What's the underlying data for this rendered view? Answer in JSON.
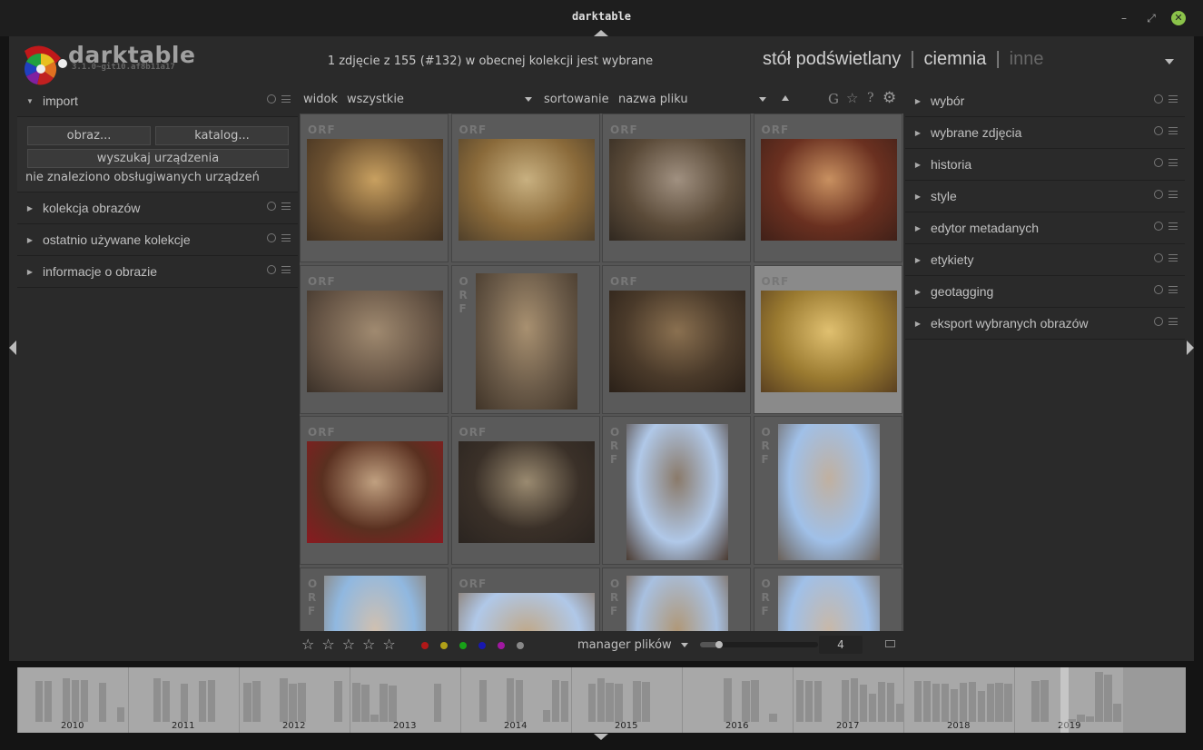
{
  "window": {
    "title": "darktable"
  },
  "brand": {
    "name": "darktable",
    "version": "3.1.0~git10.af8b11a17"
  },
  "header": {
    "info": "1 zdjęcie z 155 (#132) w obecnej kolekcji jest wybrane",
    "views": [
      "stół podświetlany",
      "ciemnia",
      "inne"
    ],
    "separator": "|"
  },
  "left": {
    "import": {
      "label": "import",
      "buttons": {
        "image": "obraz...",
        "folder": "katalog...",
        "scan": "wyszukaj urządzenia"
      },
      "no_devices": "nie znaleziono obsługiwanych urządzeń"
    },
    "modules": [
      "kolekcja obrazów",
      "ostatnio używane kolekcje",
      "informacje o obrazie"
    ]
  },
  "right": {
    "modules": [
      "wybór",
      "wybrane zdjęcia",
      "historia",
      "style",
      "edytor metadanych",
      "etykiety",
      "geotagging",
      "eksport wybranych obrazów"
    ]
  },
  "toolbar": {
    "view_label": "widok",
    "view_value": "wszystkie",
    "sort_label": "sortowanie",
    "sort_value": "nazwa pliku",
    "icon_g": "G",
    "icon_star": "☆",
    "icon_help": "?"
  },
  "grid": {
    "badge": "ORF",
    "thumbs": [
      {
        "colors": [
          "#6b5030",
          "#c8a060",
          "#403020"
        ]
      },
      {
        "colors": [
          "#8a6a3a",
          "#c8b080",
          "#50402a"
        ]
      },
      {
        "colors": [
          "#5a4a38",
          "#a09080",
          "#302820"
        ]
      },
      {
        "colors": [
          "#6a3020",
          "#c89060",
          "#402018"
        ]
      },
      {
        "colors": [
          "#6a5848",
          "#a08a70",
          "#3a3028"
        ]
      },
      {
        "colors": [
          "#6a5a48",
          "#a89070",
          "#403428"
        ]
      },
      {
        "colors": [
          "#4a3a2a",
          "#8a7050",
          "#2a2018"
        ]
      },
      {
        "colors": [
          "#9a7a30",
          "#e0c070",
          "#5a4020"
        ]
      },
      {
        "colors": [
          "#5a3020",
          "#c0a080",
          "#8a1a20"
        ]
      },
      {
        "colors": [
          "#3a3028",
          "#9a8a70",
          "#2a2420"
        ]
      },
      {
        "colors": [
          "#b0c8e8",
          "#8a7a6a",
          "#4a3a30"
        ]
      },
      {
        "colors": [
          "#a0c0e8",
          "#c0b0a0",
          "#6a6058"
        ]
      },
      {
        "colors": [
          "#90b8e0",
          "#d0c0b0",
          "#8a7a6a"
        ]
      },
      {
        "colors": [
          "#b0c8e8",
          "#c0a888",
          "#806850"
        ]
      },
      {
        "colors": [
          "#a8c0e0",
          "#b09878",
          "#705840"
        ]
      },
      {
        "colors": [
          "#a0c0e8",
          "#c8b8a8",
          "#7a6a5a"
        ]
      }
    ],
    "selected_index": 7
  },
  "bottom": {
    "stars": [
      "☆",
      "☆",
      "☆",
      "☆",
      "☆"
    ],
    "color_labels": [
      "#b01818",
      "#b0a018",
      "#18a018",
      "#1818b0",
      "#a018a0",
      "#888888"
    ],
    "layout_label": "manager plików",
    "zoom": "4"
  },
  "timeline": {
    "years": [
      "2010",
      "2011",
      "2012",
      "2013",
      "2014",
      "2015",
      "2016",
      "2017",
      "2018",
      "2019"
    ],
    "bars": [
      0,
      0,
      0.78,
      0.78,
      0,
      0.82,
      0.8,
      0.79,
      0,
      0.75,
      0,
      0.28,
      0,
      0,
      0,
      0.83,
      0.78,
      0,
      0.72,
      0,
      0.78,
      0.8,
      0,
      0,
      0,
      0.75,
      0.78,
      0,
      0,
      0.82,
      0.72,
      0.75,
      0,
      0,
      0,
      0.78,
      0,
      0.75,
      0.7,
      0.14,
      0.72,
      0.69,
      0,
      0,
      0,
      0,
      0.73,
      0,
      0,
      0,
      0,
      0.8,
      0,
      0,
      0.82,
      0.8,
      0,
      0,
      0.22,
      0.8,
      0.78,
      0,
      0,
      0.73,
      0.82,
      0.74,
      0.73,
      0,
      0.77,
      0.76,
      0,
      0,
      0,
      0,
      0,
      0,
      0,
      0,
      0.83,
      0,
      0.78,
      0.8,
      0,
      0.15,
      0,
      0,
      0.79,
      0.78,
      0.78,
      0,
      0,
      0.79,
      0.82,
      0.71,
      0.53,
      0.76,
      0.75,
      0.35,
      0,
      0.78,
      0.77,
      0.73,
      0.72,
      0.62,
      0.75,
      0.76,
      0.58,
      0.73,
      0.74,
      0.73,
      0,
      0,
      0.78,
      0.79,
      0,
      0,
      0.06,
      0.14,
      0.1,
      0.95,
      0.9,
      0.35,
      0,
      0,
      0,
      0,
      0,
      0,
      0
    ]
  }
}
